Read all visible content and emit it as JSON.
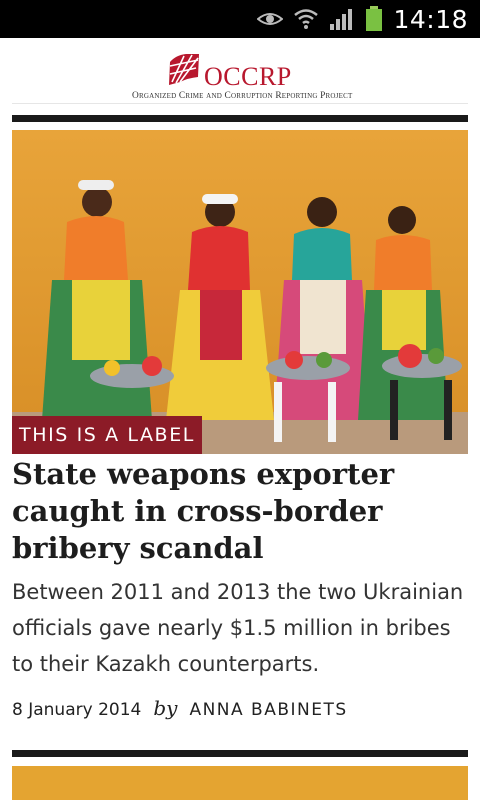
{
  "status_bar": {
    "time": "14:18",
    "icons": [
      "eye-icon",
      "wifi-icon",
      "signal-icon",
      "battery-icon"
    ],
    "battery_color": "#7ac142"
  },
  "header": {
    "logo_name": "OCCRP",
    "logo_subtitle": "Organized Crime and Corruption Reporting Project",
    "brand_color": "#b8182e"
  },
  "articles": [
    {
      "label": "THIS IS A LABEL",
      "headline": "State weapons exporter caught in cross-border bribery scandal",
      "dek": "Between 2011 and 2013 the two Ukrainian officials gave nearly $1.5 million in bribes to their Kazakh counterparts.",
      "date": "8 January 2014",
      "by": "by",
      "author": "ANNA BABINETS",
      "label_color": "#8c1b27"
    }
  ]
}
